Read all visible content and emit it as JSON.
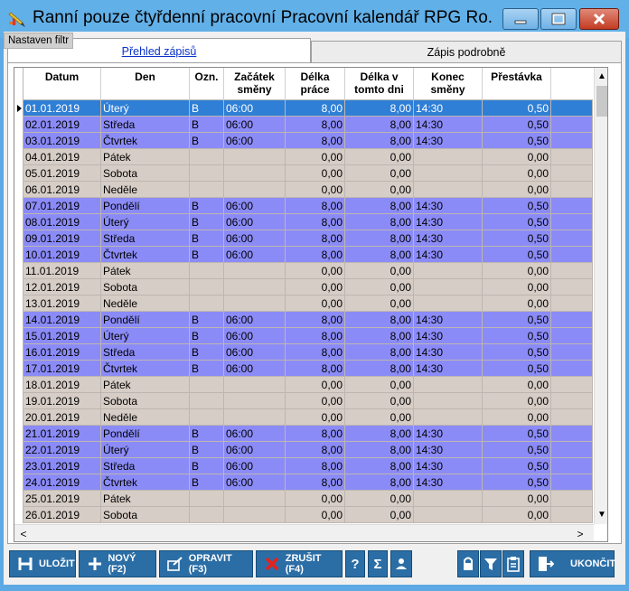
{
  "window": {
    "title": "Ranní pouze čtyřdenní pracovní Pracovní kalendář  RPG  Ro...",
    "filter_label": "Nastaven filtr"
  },
  "tabs": [
    {
      "label": "Přehled zápisů",
      "active": true
    },
    {
      "label": "Zápis podrobně",
      "active": false
    }
  ],
  "columns": [
    "Datum",
    "Den",
    "Ozn.",
    "Začátek\nsměny",
    "Délka\npráce",
    "Délka v\ntomto dni",
    "Konec\nsměny",
    "Přestávka"
  ],
  "rows": [
    {
      "date": "01.01.2019",
      "day": "Úterý",
      "mark": "B",
      "start": "06:00",
      "length": "8,00",
      "day_length": "8,00",
      "end": "14:30",
      "pause": "0,50",
      "type": "sel"
    },
    {
      "date": "02.01.2019",
      "day": "Středa",
      "mark": "B",
      "start": "06:00",
      "length": "8,00",
      "day_length": "8,00",
      "end": "14:30",
      "pause": "0,50",
      "type": "work"
    },
    {
      "date": "03.01.2019",
      "day": "Čtvrtek",
      "mark": "B",
      "start": "06:00",
      "length": "8,00",
      "day_length": "8,00",
      "end": "14:30",
      "pause": "0,50",
      "type": "work"
    },
    {
      "date": "04.01.2019",
      "day": "Pátek",
      "mark": "",
      "start": "",
      "length": "0,00",
      "day_length": "0,00",
      "end": "",
      "pause": "0,00",
      "type": "free"
    },
    {
      "date": "05.01.2019",
      "day": "Sobota",
      "mark": "",
      "start": "",
      "length": "0,00",
      "day_length": "0,00",
      "end": "",
      "pause": "0,00",
      "type": "free"
    },
    {
      "date": "06.01.2019",
      "day": "Neděle",
      "mark": "",
      "start": "",
      "length": "0,00",
      "day_length": "0,00",
      "end": "",
      "pause": "0,00",
      "type": "free"
    },
    {
      "date": "07.01.2019",
      "day": "Pondělí",
      "mark": "B",
      "start": "06:00",
      "length": "8,00",
      "day_length": "8,00",
      "end": "14:30",
      "pause": "0,50",
      "type": "work"
    },
    {
      "date": "08.01.2019",
      "day": "Úterý",
      "mark": "B",
      "start": "06:00",
      "length": "8,00",
      "day_length": "8,00",
      "end": "14:30",
      "pause": "0,50",
      "type": "work"
    },
    {
      "date": "09.01.2019",
      "day": "Středa",
      "mark": "B",
      "start": "06:00",
      "length": "8,00",
      "day_length": "8,00",
      "end": "14:30",
      "pause": "0,50",
      "type": "work"
    },
    {
      "date": "10.01.2019",
      "day": "Čtvrtek",
      "mark": "B",
      "start": "06:00",
      "length": "8,00",
      "day_length": "8,00",
      "end": "14:30",
      "pause": "0,50",
      "type": "work"
    },
    {
      "date": "11.01.2019",
      "day": "Pátek",
      "mark": "",
      "start": "",
      "length": "0,00",
      "day_length": "0,00",
      "end": "",
      "pause": "0,00",
      "type": "free"
    },
    {
      "date": "12.01.2019",
      "day": "Sobota",
      "mark": "",
      "start": "",
      "length": "0,00",
      "day_length": "0,00",
      "end": "",
      "pause": "0,00",
      "type": "free"
    },
    {
      "date": "13.01.2019",
      "day": "Neděle",
      "mark": "",
      "start": "",
      "length": "0,00",
      "day_length": "0,00",
      "end": "",
      "pause": "0,00",
      "type": "free"
    },
    {
      "date": "14.01.2019",
      "day": "Pondělí",
      "mark": "B",
      "start": "06:00",
      "length": "8,00",
      "day_length": "8,00",
      "end": "14:30",
      "pause": "0,50",
      "type": "work"
    },
    {
      "date": "15.01.2019",
      "day": "Úterý",
      "mark": "B",
      "start": "06:00",
      "length": "8,00",
      "day_length": "8,00",
      "end": "14:30",
      "pause": "0,50",
      "type": "work"
    },
    {
      "date": "16.01.2019",
      "day": "Středa",
      "mark": "B",
      "start": "06:00",
      "length": "8,00",
      "day_length": "8,00",
      "end": "14:30",
      "pause": "0,50",
      "type": "work"
    },
    {
      "date": "17.01.2019",
      "day": "Čtvrtek",
      "mark": "B",
      "start": "06:00",
      "length": "8,00",
      "day_length": "8,00",
      "end": "14:30",
      "pause": "0,50",
      "type": "work"
    },
    {
      "date": "18.01.2019",
      "day": "Pátek",
      "mark": "",
      "start": "",
      "length": "0,00",
      "day_length": "0,00",
      "end": "",
      "pause": "0,00",
      "type": "free"
    },
    {
      "date": "19.01.2019",
      "day": "Sobota",
      "mark": "",
      "start": "",
      "length": "0,00",
      "day_length": "0,00",
      "end": "",
      "pause": "0,00",
      "type": "free"
    },
    {
      "date": "20.01.2019",
      "day": "Neděle",
      "mark": "",
      "start": "",
      "length": "0,00",
      "day_length": "0,00",
      "end": "",
      "pause": "0,00",
      "type": "free"
    },
    {
      "date": "21.01.2019",
      "day": "Pondělí",
      "mark": "B",
      "start": "06:00",
      "length": "8,00",
      "day_length": "8,00",
      "end": "14:30",
      "pause": "0,50",
      "type": "work"
    },
    {
      "date": "22.01.2019",
      "day": "Úterý",
      "mark": "B",
      "start": "06:00",
      "length": "8,00",
      "day_length": "8,00",
      "end": "14:30",
      "pause": "0,50",
      "type": "work"
    },
    {
      "date": "23.01.2019",
      "day": "Středa",
      "mark": "B",
      "start": "06:00",
      "length": "8,00",
      "day_length": "8,00",
      "end": "14:30",
      "pause": "0,50",
      "type": "work"
    },
    {
      "date": "24.01.2019",
      "day": "Čtvrtek",
      "mark": "B",
      "start": "06:00",
      "length": "8,00",
      "day_length": "8,00",
      "end": "14:30",
      "pause": "0,50",
      "type": "work"
    },
    {
      "date": "25.01.2019",
      "day": "Pátek",
      "mark": "",
      "start": "",
      "length": "0,00",
      "day_length": "0,00",
      "end": "",
      "pause": "0,00",
      "type": "free"
    },
    {
      "date": "26.01.2019",
      "day": "Sobota",
      "mark": "",
      "start": "",
      "length": "0,00",
      "day_length": "0,00",
      "end": "",
      "pause": "0,00",
      "type": "free"
    }
  ],
  "toolbar": {
    "save": "ULOŽIT",
    "new": "NOVÝ (F2)",
    "edit": "OPRAVIT (F3)",
    "cancel": "ZRUŠIT (F4)",
    "help": "?",
    "sum": "Σ",
    "exit": "UKONČIT"
  },
  "colors": {
    "work_row": "#8b8bf8",
    "free_row": "#d6cdc6",
    "selected_row": "#2f7fd6",
    "toolbar_button": "#2b6ea6"
  }
}
